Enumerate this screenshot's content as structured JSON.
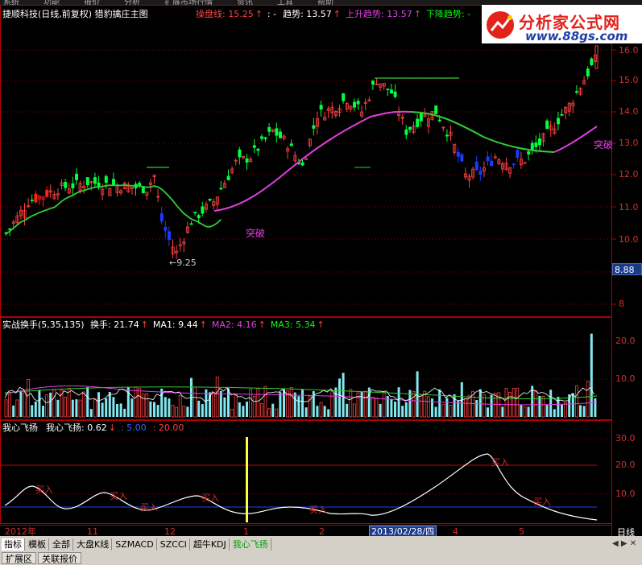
{
  "menu": [
    "系统",
    "功能",
    "报价",
    "分析",
    "扩展市场行情",
    "资讯",
    "工具",
    "帮助"
  ],
  "main": {
    "title": "捷顺科技(日线,前复权) 猎豹擒庄主图",
    "items": [
      {
        "label": "操盘线: 15.25",
        "arrow": "↑",
        "color": "#ff4040"
      },
      {
        "label": ": -",
        "arrow": "",
        "color": "#ffffff"
      },
      {
        "label": "趋势: 13.57",
        "arrow": "↑",
        "color": "#ffffff"
      },
      {
        "label": "上升趋势: 13.57",
        "arrow": "↑",
        "color": "#e040e0"
      },
      {
        "label": "下降趋势: -",
        "arrow": "",
        "color": "#00ff00"
      }
    ],
    "axis": [
      "16.0",
      "15.0",
      "14.0",
      "13.0",
      "12.0",
      "11.0",
      "10.0",
      "8"
    ],
    "price_box": "8.88",
    "annotations": {
      "low": "←9.25",
      "breakout1": "突破",
      "breakout2": "突破"
    }
  },
  "volume": {
    "title": "实战换手(5,35,135)",
    "items": [
      {
        "label": "换手: 21.74",
        "arrow": "↑",
        "color": "#ffffff"
      },
      {
        "label": "MA1: 9.44",
        "arrow": "↑",
        "color": "#ffffff"
      },
      {
        "label": "MA2: 4.16",
        "arrow": "↑",
        "color": "#e040e0"
      },
      {
        "label": "MA3: 5.34",
        "arrow": "↑",
        "color": "#00ff00"
      }
    ],
    "axis": [
      "20.0",
      "10.0"
    ]
  },
  "indicator": {
    "title": "我心飞扬",
    "items": [
      {
        "label": "我心飞扬: 0.62",
        "arrow": "↓",
        "color": "#ffffff"
      },
      {
        "label": ": 5.00",
        "arrow": "",
        "color": "#4060ff"
      },
      {
        "label": ": 20.00",
        "arrow": "",
        "color": "#ff4040"
      }
    ],
    "axis": [
      "30.0",
      "20.0",
      "10.0"
    ],
    "signals": [
      "买入",
      "买入",
      "买入",
      "买入",
      "买入",
      "买入",
      "买入"
    ]
  },
  "timeline": {
    "labels": [
      "2012年",
      "11",
      "12",
      "1",
      "2",
      "4",
      "5"
    ],
    "cursor_date": "2013/02/28/四",
    "period": "日线"
  },
  "tabs": [
    "指标",
    "模板",
    "全部",
    "大盘K线",
    "SZMACD",
    "SZCCI",
    "超牛KDJ",
    "我心飞扬"
  ],
  "bottom_tabs": [
    "扩展区",
    "关联报价"
  ],
  "brand": {
    "name": "分析家公式网",
    "url": "www.88gs.com"
  },
  "colors": {
    "up": "#ff4040",
    "down": "#0066ff",
    "trend_green": "#33cc33",
    "trend_magenta": "#e040e0",
    "grid": "#8b0000"
  }
}
